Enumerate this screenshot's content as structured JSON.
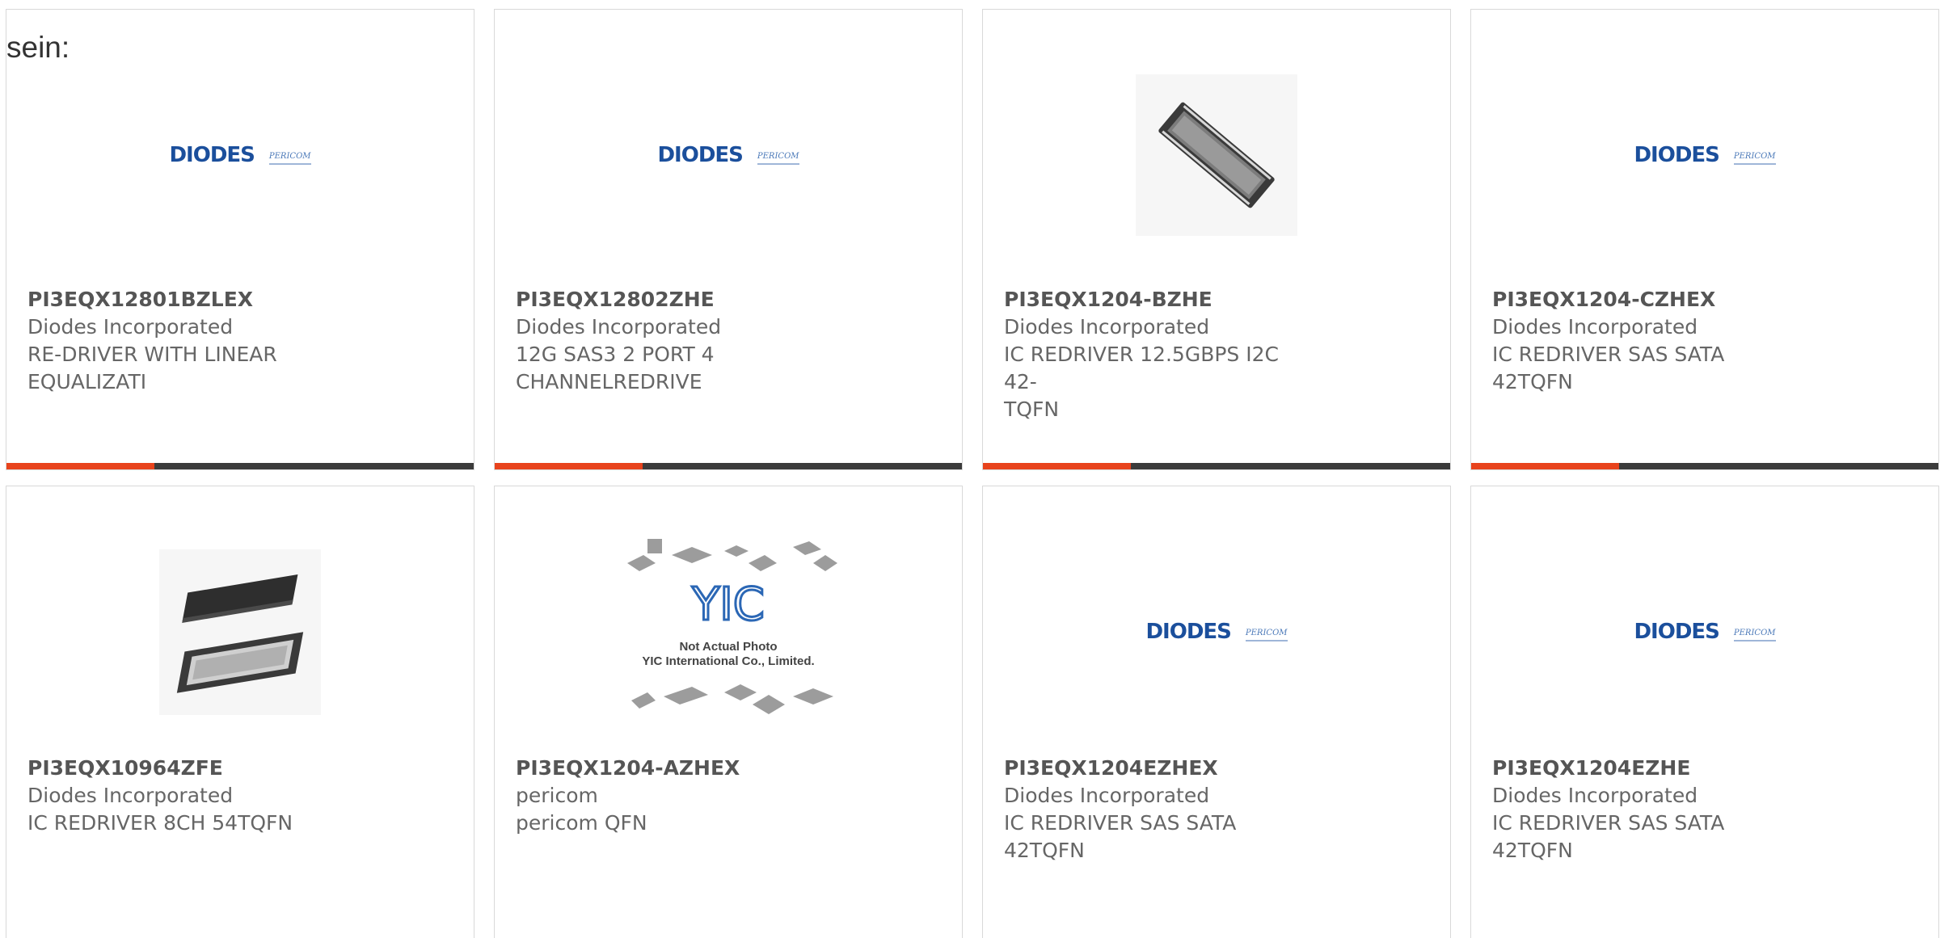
{
  "intro_text": "sein:",
  "accent_color": "#e8431c",
  "bar_color": "#3b3b3b",
  "products": [
    {
      "part": "PI3EQX12801BZLEX",
      "maker": "Diodes Incorporated",
      "desc1": "RE-DRIVER WITH LINEAR",
      "desc2": "EQUALIZATI",
      "image": "diodes-pericom-logo",
      "logo_main": "DIODES",
      "logo_side": "PERICOM"
    },
    {
      "part": "PI3EQX12802ZHE",
      "maker": "Diodes Incorporated",
      "desc1": "12G SAS3 2 PORT 4",
      "desc2": "CHANNELREDRIVE",
      "image": "diodes-pericom-logo",
      "logo_main": "DIODES",
      "logo_side": "PERICOM"
    },
    {
      "part": "PI3EQX1204-BZHE",
      "maker": "Diodes Incorporated",
      "desc1": "IC REDRIVER 12.5GBPS I2C 42-",
      "desc2": "TQFN",
      "image": "tqfn-chip-photo"
    },
    {
      "part": "PI3EQX1204-CZHEX",
      "maker": "Diodes Incorporated",
      "desc1": "IC REDRIVER SAS SATA 42TQFN",
      "desc2": "",
      "image": "diodes-pericom-logo",
      "logo_main": "DIODES",
      "logo_side": "PERICOM"
    },
    {
      "part": "PI3EQX10964ZFE",
      "maker": "Diodes Incorporated",
      "desc1": "IC REDRIVER 8CH 54TQFN",
      "desc2": "",
      "image": "qfn-chip-pair-photo"
    },
    {
      "part": "PI3EQX1204-AZHEX",
      "maker": "pericom",
      "desc1": "pericom QFN",
      "desc2": "",
      "image": "yic-placeholder",
      "placeholder_line1": "Not Actual Photo",
      "placeholder_line2": "YIC International Co., Limited."
    },
    {
      "part": "PI3EQX1204EZHEX",
      "maker": "Diodes Incorporated",
      "desc1": "IC REDRIVER SAS SATA 42TQFN",
      "desc2": "",
      "image": "diodes-pericom-logo",
      "logo_main": "DIODES",
      "logo_side": "PERICOM"
    },
    {
      "part": "PI3EQX1204EZHE",
      "maker": "Diodes Incorporated",
      "desc1": "IC REDRIVER SAS SATA 42TQFN",
      "desc2": "",
      "image": "diodes-pericom-logo",
      "logo_main": "DIODES",
      "logo_side": "PERICOM"
    }
  ]
}
